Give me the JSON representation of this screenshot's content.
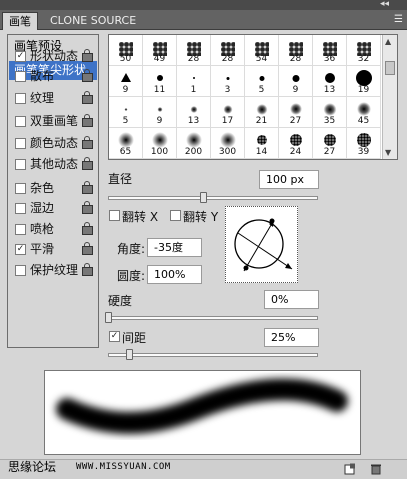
{
  "tabs": {
    "brush": "画笔",
    "clone_source": "CLONE SOURCE"
  },
  "left_panel": {
    "presets": "画笔预设",
    "tip_shape": "画笔笔尖形状",
    "items": [
      {
        "label": "形状动态",
        "checked": true
      },
      {
        "label": "散布",
        "checked": false
      },
      {
        "label": "纹理",
        "checked": false
      },
      {
        "label": "双重画笔",
        "checked": false
      },
      {
        "label": "颜色动态",
        "checked": false
      },
      {
        "label": "其他动态",
        "checked": false
      },
      {
        "label": "杂色",
        "checked": false
      },
      {
        "label": "湿边",
        "checked": false
      },
      {
        "label": "喷枪",
        "checked": false
      },
      {
        "label": "平滑",
        "checked": true
      },
      {
        "label": "保护纹理",
        "checked": false
      }
    ]
  },
  "brush_grid": {
    "rows": [
      [
        "50",
        "49",
        "28",
        "28",
        "54",
        "28",
        "36",
        "32"
      ],
      [
        "9",
        "11",
        "1",
        "3",
        "5",
        "9",
        "13",
        "19"
      ],
      [
        "5",
        "9",
        "13",
        "17",
        "21",
        "27",
        "35",
        "45"
      ],
      [
        "65",
        "100",
        "200",
        "300",
        "14",
        "24",
        "27",
        "39"
      ]
    ]
  },
  "diameter": {
    "label": "直径",
    "value": "100 px",
    "slider_fraction": 0.45
  },
  "flip_x": {
    "label": "翻转 X",
    "checked": false
  },
  "flip_y": {
    "label": "翻转 Y",
    "checked": false
  },
  "angle": {
    "label": "角度:",
    "value": "-35度"
  },
  "roundness": {
    "label": "圆度:",
    "value": "100%"
  },
  "hardness": {
    "label": "硬度",
    "value": "0%",
    "slider_fraction": 0.0
  },
  "spacing": {
    "label": "间距",
    "value": "25%",
    "checked": true,
    "slider_fraction": 0.1
  },
  "footer": {
    "watermark": "思缘论坛",
    "url": "WWW.MISSYUAN.COM"
  },
  "icons": {
    "check": "✓",
    "menu": "☰",
    "collapse": "◂◂"
  }
}
